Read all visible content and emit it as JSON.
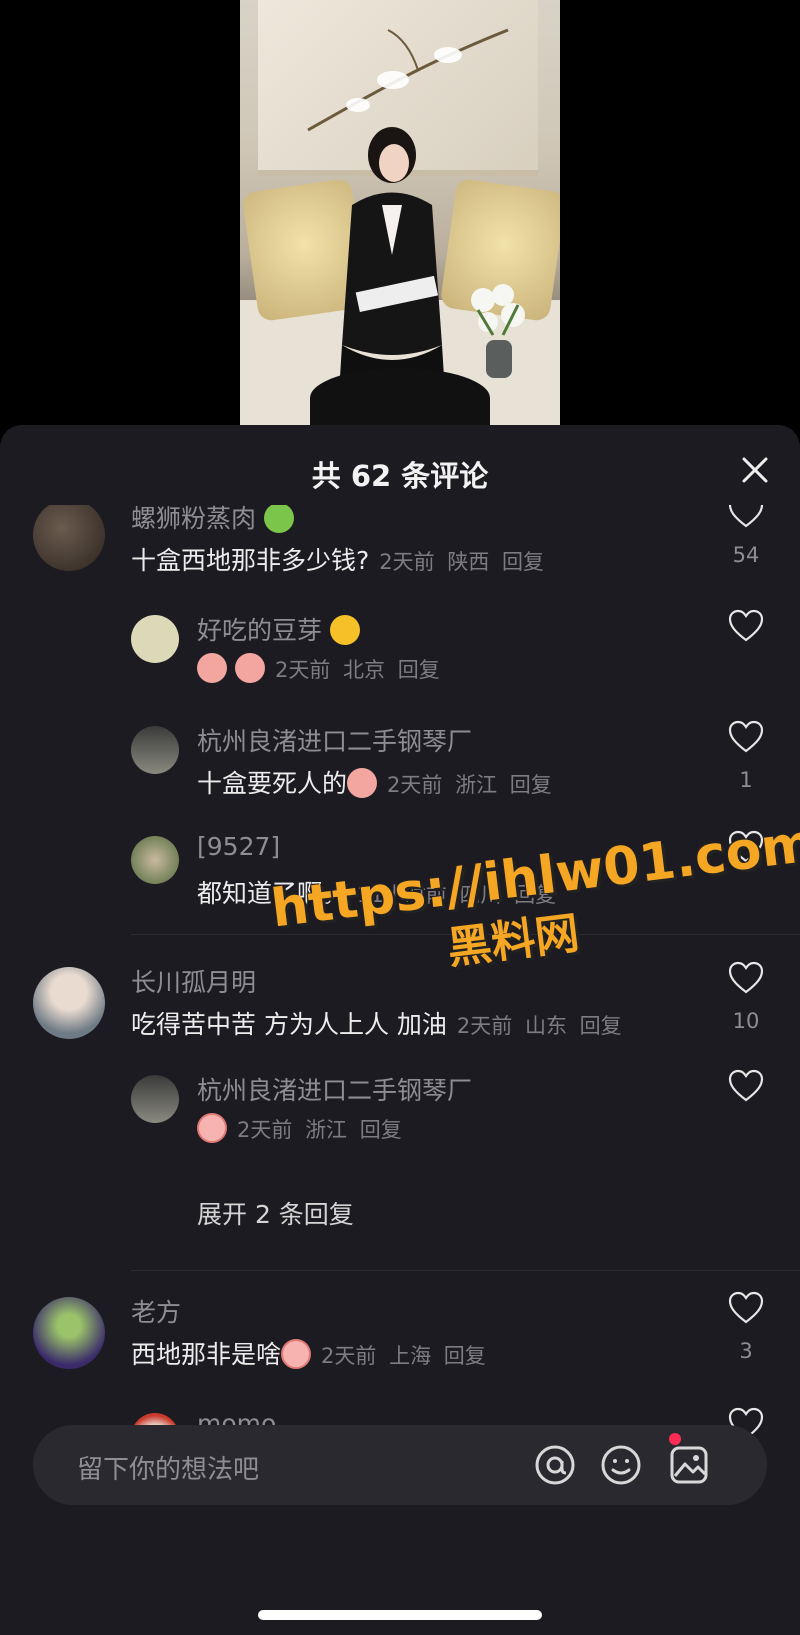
{
  "header": {
    "title": "共 62 条评论"
  },
  "comments": [
    {
      "user": "螺狮粉蒸肉",
      "user_emoji": "frog-emoji",
      "text": "十盒西地那非多少钱?",
      "time": "2天前",
      "location": "陕西",
      "reply": "回复",
      "likes": "54"
    },
    {
      "user": "好吃的豆芽",
      "user_emoji": "smile-emoji",
      "text": "",
      "time": "2天前",
      "location": "北京",
      "reply": "回复",
      "likes": ""
    },
    {
      "user": "杭州良渚进口二手钢琴厂",
      "text": "十盒要死人的",
      "time": "2天前",
      "location": "浙江",
      "reply": "回复",
      "likes": "1"
    },
    {
      "user": "[9527]",
      "text": "都知道了啊。",
      "time": "11小时前",
      "location": "四川",
      "reply": "回复",
      "likes": ""
    },
    {
      "user": "长川孤月明",
      "text": "吃得苦中苦 方为人上人 加油",
      "time": "2天前",
      "location": "山东",
      "reply": "回复",
      "likes": "10"
    },
    {
      "user": "杭州良渚进口二手钢琴厂",
      "text": "",
      "time": "2天前",
      "location": "浙江",
      "reply": "回复",
      "likes": ""
    },
    {
      "user": "老方",
      "text": "西地那非是啥",
      "time": "2天前",
      "location": "上海",
      "reply": "回复",
      "likes": "3"
    },
    {
      "user": "momo",
      "text": "",
      "time": "",
      "location": "",
      "reply": "",
      "likes": ""
    }
  ],
  "expand_replies": "展开 2 条回复",
  "input": {
    "placeholder": "留下你的想法吧"
  },
  "watermark": {
    "url": "https://ihlw01.com",
    "name": "黑料网"
  },
  "colors": {
    "sheet_bg": "#1c1b21",
    "notification_dot": "#ff2d55",
    "watermark": "#f5a623"
  }
}
